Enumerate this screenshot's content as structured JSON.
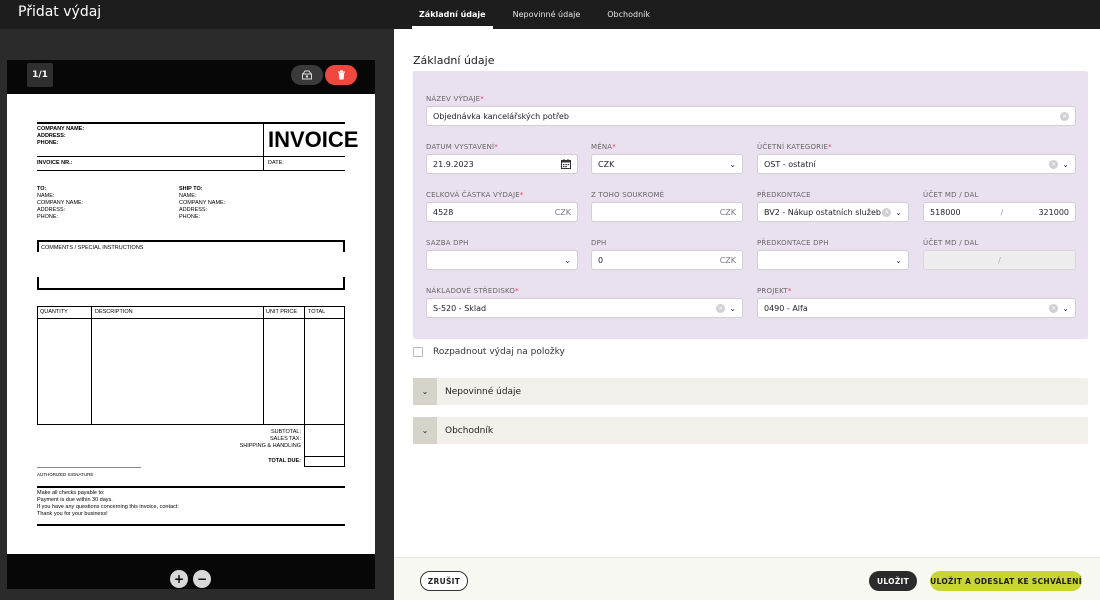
{
  "app": {
    "title": "Přidat výdaj"
  },
  "tabs": [
    {
      "label": "Základní údaje",
      "active": true
    },
    {
      "label": "Nepovinné údaje",
      "active": false
    },
    {
      "label": "Obchodník",
      "active": false
    }
  ],
  "preview": {
    "page_counter": "1/1",
    "zoom_in": "+",
    "zoom_out": "−",
    "invoice": {
      "company_name": "COMPANY NAME:",
      "address": "ADDRESS:",
      "phone": "PHONE:",
      "title": "INVOICE",
      "invoice_nr": "INVOICE NR.:",
      "date": "DATE:",
      "to": "TO:",
      "to_name": "NAME:",
      "to_company": "COMPANY NAME:",
      "to_address": "ADDRESS:",
      "to_phone": "PHONE:",
      "ship_to": "SHIP TO:",
      "ship_name": "NAME:",
      "ship_company": "COMPANY NAME:",
      "ship_address": "ADDRESS:",
      "ship_phone": "PHONE:",
      "comments": "COMMENTS / SPECIAL INSTRUCTIONS",
      "col_quantity": "QUANTITY",
      "col_description": "DESCRIPTION",
      "col_unit_price": "UNIT PRICE",
      "col_total": "TOTAL",
      "subtotal": "SUBTOTAL:",
      "sales_tax": "SALES TAX:",
      "shipping": "SHIPPING & HANDLING",
      "total_due": "TOTAL DUE:",
      "signature": "AUTHORIZED SIGNATURE",
      "note1": "Make all checks payable to:",
      "note2": "Payment is due within 30 days.",
      "note3": "If you have any questions concerning this invoice, contact:",
      "note4": "Thank you for your business!"
    }
  },
  "form": {
    "section_title": "Základní údaje",
    "expense_name": {
      "label": "NÁZEV VÝDAJE",
      "value": "Objednávka kancelářských potřeb"
    },
    "issue_date": {
      "label": "DATUM VYSTAVENÍ",
      "value": "21.9.2023"
    },
    "currency": {
      "label": "MĚNA",
      "value": "CZK"
    },
    "accounting_category": {
      "label": "ÚČETNÍ KATEGORIE",
      "value": "OST - ostatní"
    },
    "total_amount": {
      "label": "CELKOVÁ ČÁSTKA VÝDAJE",
      "value": "4528",
      "suffix": "CZK"
    },
    "private_part": {
      "label": "Z TOHO SOUKROMÉ",
      "value": "",
      "suffix": "CZK"
    },
    "pre_account": {
      "label": "PŘEDKONTACE",
      "value": "BV2 - Nákup ostatních služeb"
    },
    "account_md_dal": {
      "label": "ÚČET MD / DAL",
      "md": "518000",
      "separator": "/",
      "dal": "321000"
    },
    "vat_rate": {
      "label": "SAZBA DPH",
      "value": ""
    },
    "vat": {
      "label": "DPH",
      "value": "0",
      "suffix": "CZK"
    },
    "vat_pre_account": {
      "label": "PŘEDKONTACE DPH",
      "value": ""
    },
    "vat_account_md_dal": {
      "label": "ÚČET MD / DAL",
      "separator": "/"
    },
    "cost_center": {
      "label": "NÁKLADOVÉ STŘEDISKO",
      "value": "S-520 - Sklad"
    },
    "project": {
      "label": "PROJEKT",
      "value": "0490 - Alfa"
    },
    "split_items": "Rozpadnout výdaj na položky",
    "accordion_optional": "Nepovinné údaje",
    "accordion_merchant": "Obchodník"
  },
  "footer": {
    "cancel": "ZRUŠIT",
    "save": "ULOŽIT",
    "save_send": "ULOŽIT A ODESLAT KE SCHVÁLENÍ"
  },
  "colors": {
    "accent": "#c9d437",
    "form_bg": "#e9e1f0",
    "delete": "#f0483f",
    "required": "#e0405a"
  },
  "icons": [
    "reocr-icon",
    "trash-icon",
    "calendar-icon",
    "clear-icon",
    "chevron-down-icon"
  ]
}
